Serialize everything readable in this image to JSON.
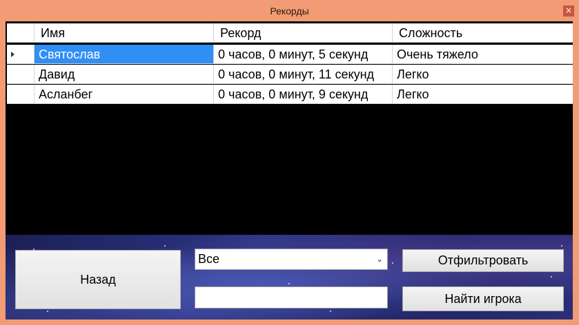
{
  "window": {
    "title": "Рекорды",
    "close_glyph": "×"
  },
  "grid": {
    "columns": [
      "Имя",
      "Рекорд",
      "Сложность"
    ],
    "rows": [
      {
        "name": "Святослав",
        "record": "0 часов, 0 минут, 5 секунд",
        "difficulty": "Очень тяжело",
        "selected": true
      },
      {
        "name": "Давид",
        "record": "0 часов, 0 минут, 11 секунд",
        "difficulty": "Легко"
      },
      {
        "name": "Асланбег",
        "record": "0 часов, 0 минут, 9 секунд",
        "difficulty": "Легко"
      }
    ]
  },
  "controls": {
    "back_label": "Назад",
    "filter_select_value": "Все",
    "filter_label": "Отфильтровать",
    "search_value": "",
    "find_player_label": "Найти игрока"
  },
  "colors": {
    "title_bar": "#f29b74",
    "selection": "#2f8ff5"
  }
}
